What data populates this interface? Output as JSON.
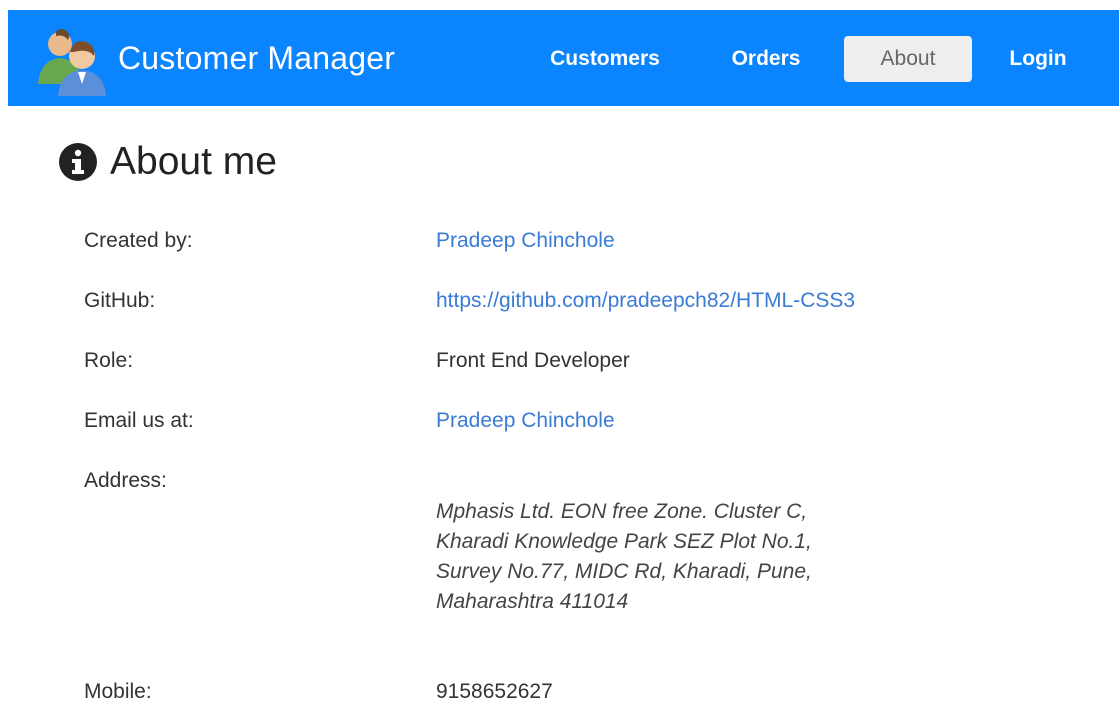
{
  "app": {
    "title": "Customer Manager",
    "logo_icon": "users-icon"
  },
  "nav": {
    "customers": "Customers",
    "orders": "Orders",
    "about": "About",
    "login": "Login",
    "active": "About"
  },
  "heading": {
    "icon": "info-circle-icon",
    "text": "About me"
  },
  "details": {
    "created_by": {
      "label": "Created by:",
      "value": "Pradeep Chinchole"
    },
    "github": {
      "label": "GitHub:",
      "value": "https://github.com/pradeepch82/HTML-CSS3"
    },
    "role": {
      "label": "Role:",
      "value": "Front End Developer"
    },
    "email": {
      "label": "Email us at:",
      "value": "Pradeep Chinchole"
    },
    "address": {
      "label": "Address:",
      "lines": [
        "Mphasis Ltd. EON free Zone. Cluster C,",
        "Kharadi Knowledge Park SEZ Plot No.1,",
        "Survey No.77, MIDC Rd, Kharadi, Pune,",
        "Maharashtra 411014"
      ]
    },
    "mobile": {
      "label": "Mobile:",
      "value": "9158652627"
    }
  },
  "colors": {
    "navbar": "#0a84ff",
    "link": "#3a7bd5",
    "active_tab_bg": "#eeeeee"
  }
}
